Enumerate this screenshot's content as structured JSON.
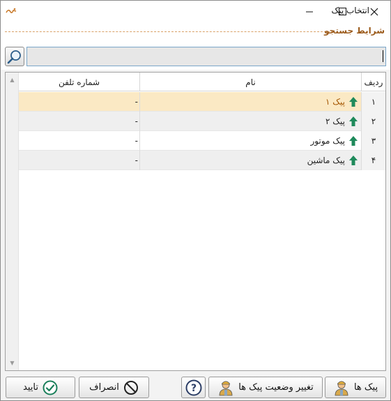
{
  "window": {
    "title": "انتخاب پیک"
  },
  "search": {
    "section_title": "شرایط جستجو",
    "value": "",
    "placeholder": ""
  },
  "table": {
    "columns": {
      "row": "ردیف",
      "name": "نام",
      "phone": "شماره تلفن"
    },
    "rows": [
      {
        "index": "۱",
        "name": "پیک ۱",
        "phone": "-",
        "selected": true
      },
      {
        "index": "۲",
        "name": "پیک ۲",
        "phone": "-",
        "selected": false
      },
      {
        "index": "۳",
        "name": "پیک موتور",
        "phone": "-",
        "selected": false
      },
      {
        "index": "۴",
        "name": "پیک ماشین",
        "phone": "-",
        "selected": false
      }
    ]
  },
  "buttons": {
    "confirm": "تایید",
    "cancel": "انصراف",
    "help_icon": "question-icon",
    "change_status": "تغییر وضعیت پیک ها",
    "couriers": "پیک ها"
  },
  "colors": {
    "selected_row": "#fbe9c4",
    "selected_text": "#a55600",
    "arrow_green": "#1f8a5b",
    "section_title": "#9b5a1a",
    "confirm_check": "#1a7f5a"
  }
}
